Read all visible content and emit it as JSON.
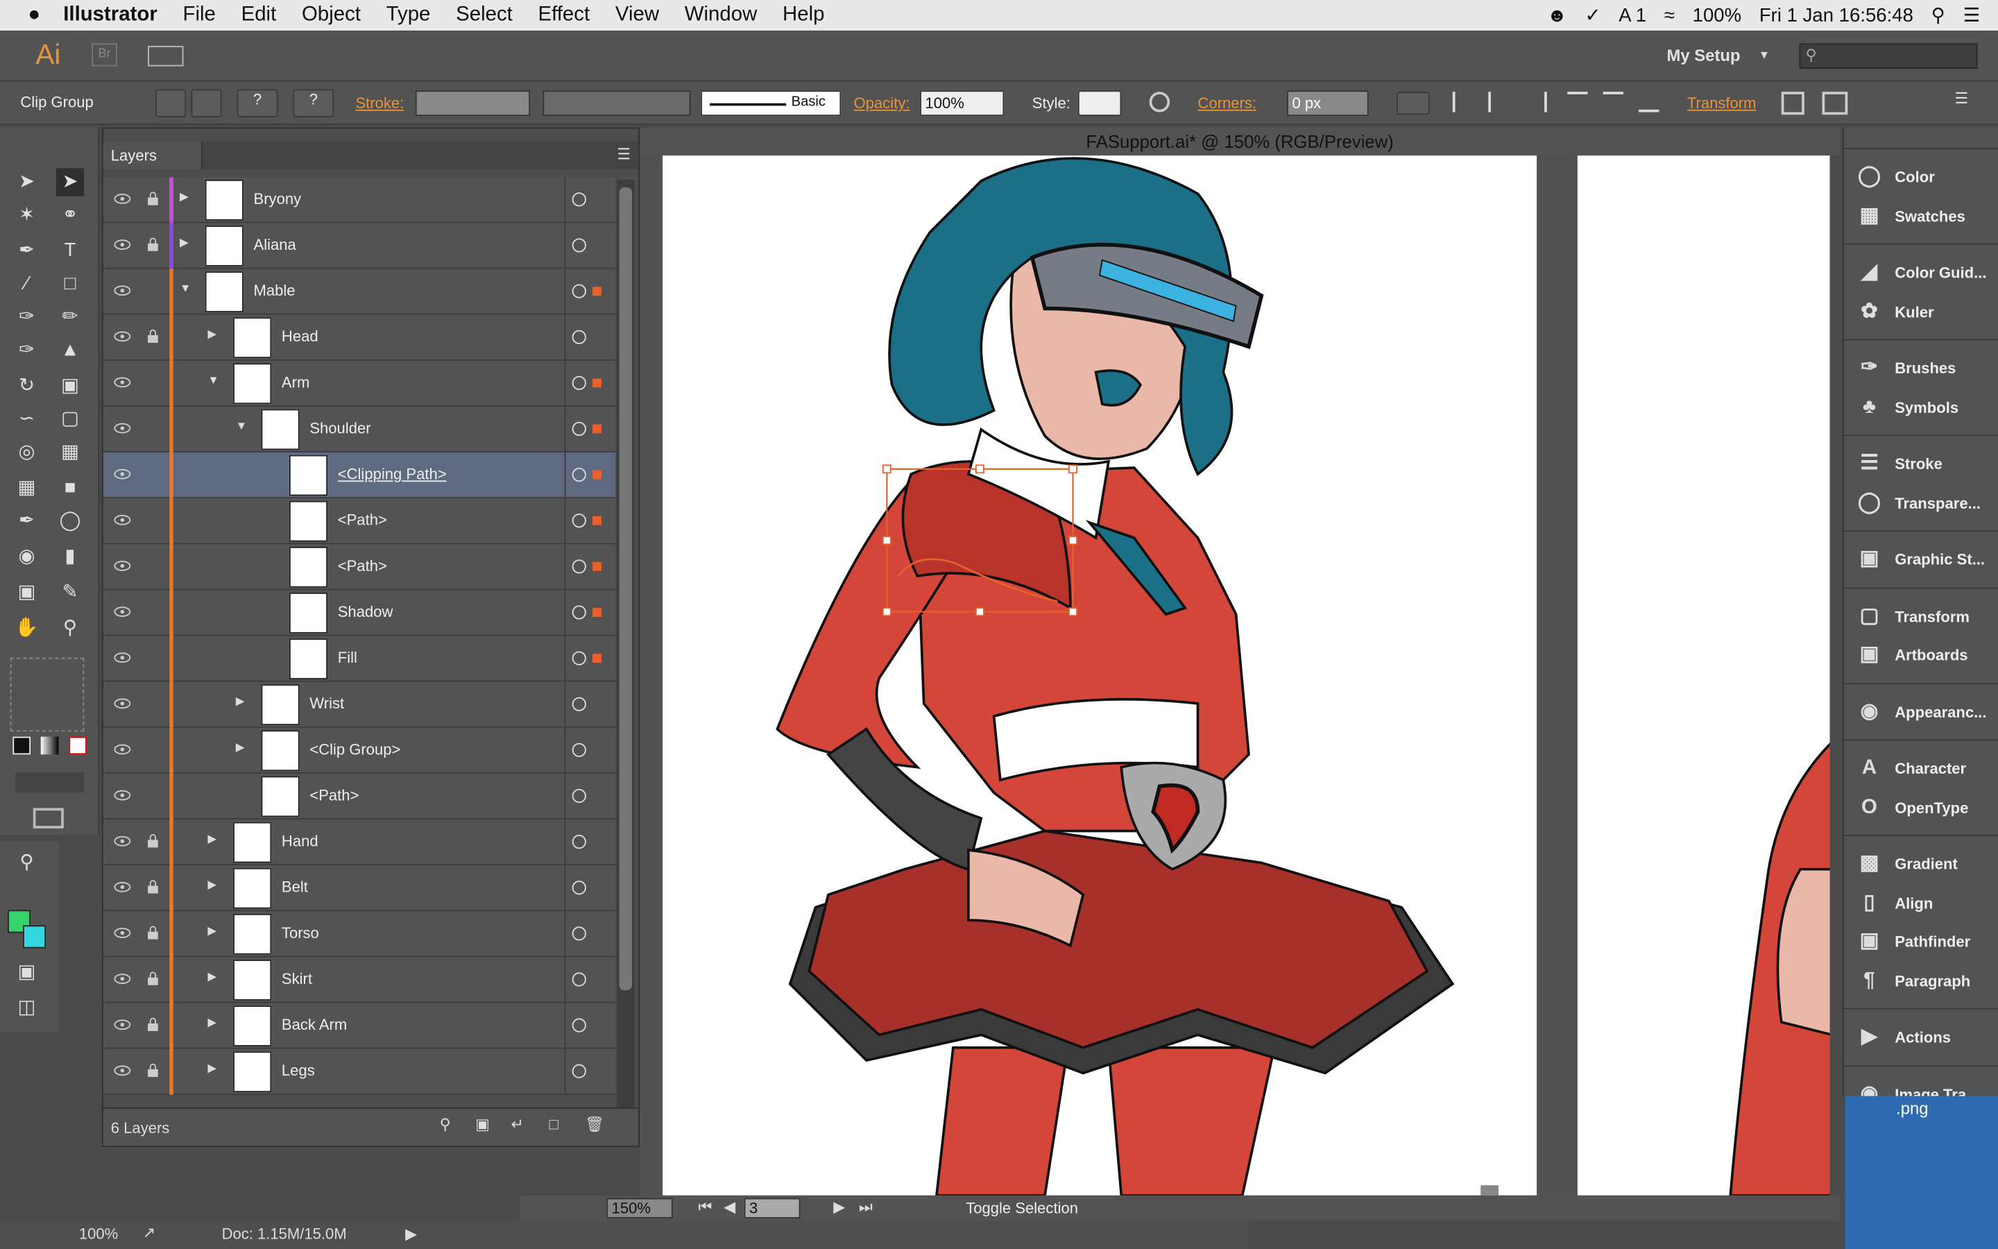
{
  "menubar": {
    "apple": "",
    "app": "Illustrator",
    "items": [
      "File",
      "Edit",
      "Object",
      "Type",
      "Select",
      "Effect",
      "View",
      "Window",
      "Help"
    ],
    "battery": "100%",
    "clock": "Fri 1 Jan  16:56:48"
  },
  "appbar": {
    "logo": "Ai",
    "br": "Br",
    "workspace": "My Setup"
  },
  "control": {
    "selection": "Clip Group",
    "stroke_label": "Stroke:",
    "brush_label": "Basic",
    "opacity_label": "Opacity:",
    "opacity_value": "100%",
    "style_label": "Style:",
    "corners_label": "Corners:",
    "corners_value": "0 px",
    "transform_label": "Transform"
  },
  "layers_panel": {
    "tab": "Layers",
    "footer": "6 Layers",
    "rows": [
      {
        "name": "Bryony",
        "color": "#c84fd8"
      },
      {
        "name": "Aliana",
        "color": "#8a4fd8"
      },
      {
        "name": "Mable",
        "color": "#e8782a"
      },
      {
        "name": "Head",
        "color": "#e8782a"
      },
      {
        "name": "Arm",
        "color": "#e8782a"
      },
      {
        "name": "Shoulder",
        "color": "#e8782a"
      },
      {
        "name": "<Clipping Path>",
        "color": "#e8782a"
      },
      {
        "name": "<Path>",
        "color": "#e8782a"
      },
      {
        "name": "<Path>",
        "color": "#e8782a"
      },
      {
        "name": "Shadow",
        "color": "#e8782a"
      },
      {
        "name": "Fill",
        "color": "#e8782a"
      },
      {
        "name": "Wrist",
        "color": "#e8782a"
      },
      {
        "name": "<Clip Group>",
        "color": "#e8782a"
      },
      {
        "name": "<Path>",
        "color": "#e8782a"
      },
      {
        "name": "Hand",
        "color": "#e8782a"
      },
      {
        "name": "Belt",
        "color": "#e8782a"
      },
      {
        "name": "Torso",
        "color": "#e8782a"
      },
      {
        "name": "Skirt",
        "color": "#e8782a"
      },
      {
        "name": "Back Arm",
        "color": "#e8782a"
      },
      {
        "name": "Legs",
        "color": "#e8782a"
      }
    ]
  },
  "document": {
    "title": "FASupport.ai* @ 150% (RGB/Preview)",
    "zoom": "150%",
    "artboard": "3",
    "status": "Toggle Selection",
    "bottom_zoom": "100%",
    "doc_size": "Doc: 1.15M/15.0M",
    "desktop_file": ".png"
  },
  "right_panel": [
    {
      "label": "Color",
      "icon": "color-icon"
    },
    {
      "label": "Swatches",
      "icon": "swatches-icon"
    },
    {
      "label": "Color Guid...",
      "icon": "color-guide-icon"
    },
    {
      "label": "Kuler",
      "icon": "kuler-icon"
    },
    {
      "label": "Brushes",
      "icon": "brushes-icon"
    },
    {
      "label": "Symbols",
      "icon": "symbols-icon"
    },
    {
      "label": "Stroke",
      "icon": "stroke-icon"
    },
    {
      "label": "Transpare...",
      "icon": "transparency-icon"
    },
    {
      "label": "Graphic St...",
      "icon": "graphic-styles-icon"
    },
    {
      "label": "Transform",
      "icon": "transform-icon"
    },
    {
      "label": "Artboards",
      "icon": "artboards-icon"
    },
    {
      "label": "Appearanc...",
      "icon": "appearance-icon"
    },
    {
      "label": "Character",
      "icon": "character-icon"
    },
    {
      "label": "OpenType",
      "icon": "opentype-icon"
    },
    {
      "label": "Gradient",
      "icon": "gradient-icon"
    },
    {
      "label": "Align",
      "icon": "align-icon"
    },
    {
      "label": "Pathfinder",
      "icon": "pathfinder-icon"
    },
    {
      "label": "Paragraph",
      "icon": "paragraph-icon"
    },
    {
      "label": "Actions",
      "icon": "actions-icon"
    },
    {
      "label": "Image Tra...",
      "icon": "image-trace-icon"
    }
  ],
  "colors": {
    "accent": "#e8933a",
    "selection": "#e8602c",
    "fill_swatch": "#36d36a",
    "stroke_swatch": "#35d8e0"
  }
}
